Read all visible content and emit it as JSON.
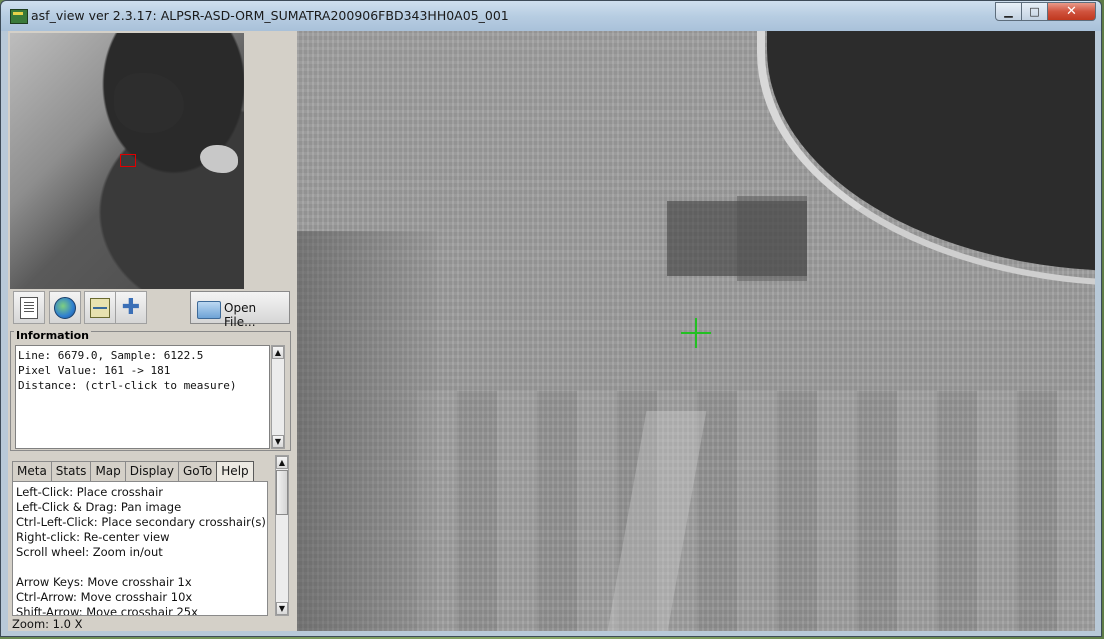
{
  "window": {
    "title": "asf_view ver 2.3.17: ALPSR-ASD-ORM_SUMATRA200906FBD343HH0A05_001",
    "minimize_glyph": "▁",
    "maximize_glyph": "□",
    "close_glyph": "✕"
  },
  "toolbar": {
    "open_file_label": "Open File...",
    "icons": [
      "document-icon",
      "globe-icon",
      "map-icon",
      "plus-icon"
    ]
  },
  "information": {
    "label": "Information",
    "lines": [
      "Line: 6679.0, Sample: 6122.5",
      "Pixel Value: 161 -> 181",
      "Distance: (ctrl-click to measure)"
    ]
  },
  "tabs": [
    {
      "label": "Meta"
    },
    {
      "label": "Stats"
    },
    {
      "label": "Map"
    },
    {
      "label": "Display"
    },
    {
      "label": "GoTo"
    },
    {
      "label": "Help",
      "active": true
    }
  ],
  "help": {
    "lines": [
      "Left-Click: Place crosshair",
      "Left-Click & Drag:  Pan image",
      "Ctrl-Left-Click: Place secondary crosshair(s)",
      "Right-click: Re-center view",
      "Scroll wheel: Zoom in/out",
      "",
      "Arrow Keys: Move crosshair 1x",
      "Ctrl-Arrow: Move crosshair 10x",
      "Shift-Arrow: Move crosshair 25x"
    ]
  },
  "status": {
    "zoom": "Zoom: 1.0 X"
  },
  "colors": {
    "crosshair": "#22c022",
    "overview_box": "#e00000"
  }
}
